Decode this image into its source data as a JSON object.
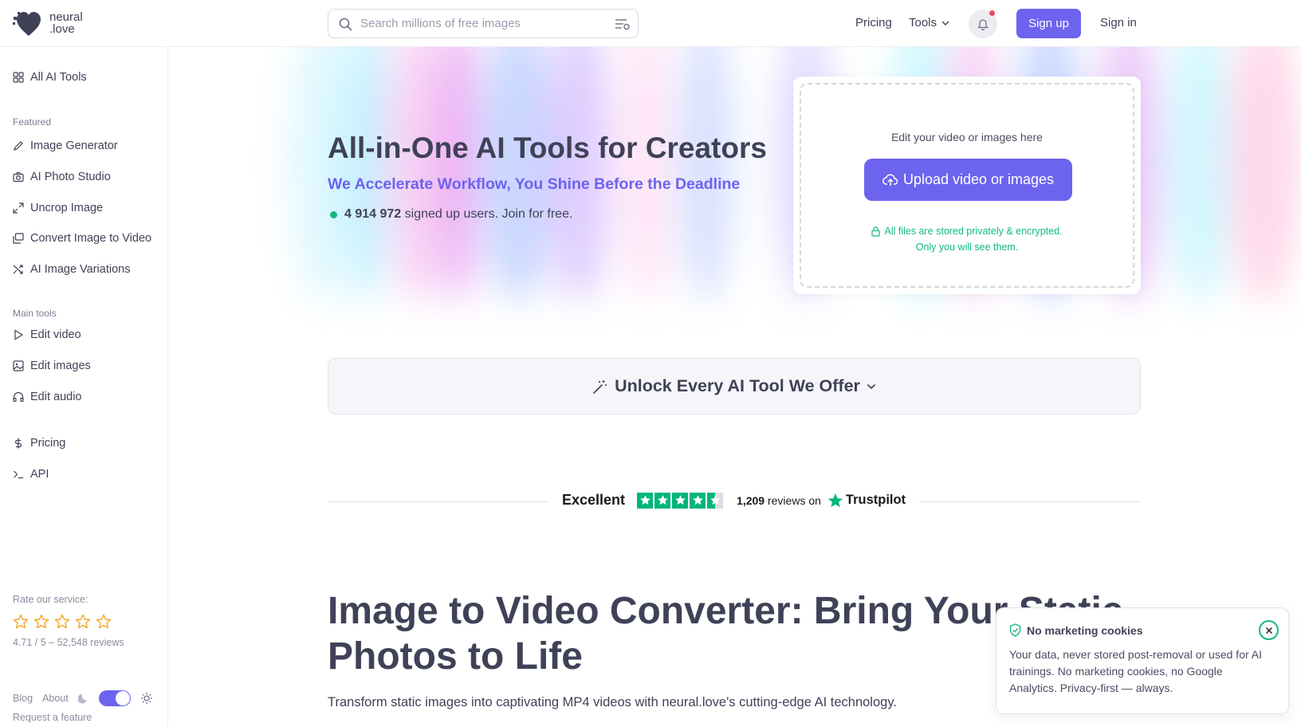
{
  "header": {
    "logo_text_line1": "neural",
    "logo_text_line2": ".love",
    "search_placeholder": "Search millions of free images",
    "nav_pricing": "Pricing",
    "nav_tools": "Tools",
    "signup_label": "Sign up",
    "signin_label": "Sign in"
  },
  "sidebar": {
    "all_tools": "All AI Tools",
    "featured_heading": "Featured",
    "featured": [
      {
        "label": "Image Generator",
        "icon": "brush-icon"
      },
      {
        "label": "AI Photo Studio",
        "icon": "camera-icon"
      },
      {
        "label": "Uncrop Image",
        "icon": "expand-icon"
      },
      {
        "label": "Convert Image to Video",
        "icon": "images-icon"
      },
      {
        "label": "AI Image Variations",
        "icon": "shuffle-icon"
      }
    ],
    "main_heading": "Main tools",
    "main": [
      {
        "label": "Edit video",
        "icon": "play-icon"
      },
      {
        "label": "Edit images",
        "icon": "image-icon"
      },
      {
        "label": "Edit audio",
        "icon": "headphones-icon"
      }
    ],
    "extra": [
      {
        "label": "Pricing",
        "icon": "dollar-icon"
      },
      {
        "label": "API",
        "icon": "terminal-icon"
      }
    ],
    "rate_label": "Rate our service:",
    "rating_text": "4.71 / 5 – 52,548 reviews",
    "blog": "Blog",
    "about": "About",
    "request_feature": "Request a feature"
  },
  "hero": {
    "title": "All-in-One AI Tools for Creators",
    "subtitle": "We Accelerate Workflow, You Shine Before the Deadline",
    "user_count": "4 914 972",
    "user_suffix": "signed up users. Join for free."
  },
  "upload": {
    "hint": "Edit your video or images here",
    "button_label": "Upload video or images",
    "privacy_line1": "All files are stored privately & encrypted.",
    "privacy_line2": "Only you will see them."
  },
  "unlock_label": "Unlock Every AI Tool We Offer",
  "trustpilot": {
    "excellent": "Excellent",
    "review_count": "1,209",
    "reviews_on": "reviews on",
    "brand": "Trustpilot"
  },
  "content": {
    "title": "Image to Video Converter: Bring Your Static Photos to Life",
    "intro": "Transform static images into captivating MP4 videos with neural.love's cutting-edge AI technology."
  },
  "cookie": {
    "title": "No marketing cookies",
    "body": "Your data, never stored post-removal or used for AI trainings. No marketing cookies, no Google Analytics. Privacy-first — always."
  },
  "colors": {
    "accent": "#6c63ef",
    "green": "#12b981",
    "text": "#3f4257",
    "star": "#f5a524",
    "trustpilot": "#00b67a"
  }
}
